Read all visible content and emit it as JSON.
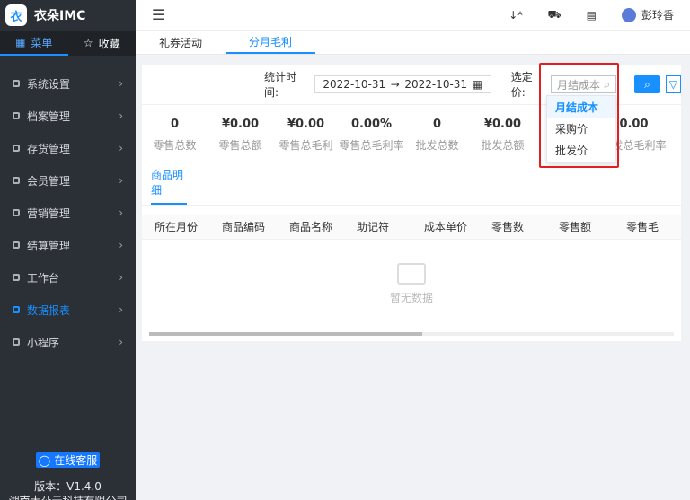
{
  "app": {
    "name": "衣朵IMC",
    "logo_text": "衣"
  },
  "side_tabs": {
    "menu": "菜单",
    "favorites": "收藏"
  },
  "menu_items": [
    {
      "label": "系统设置"
    },
    {
      "label": "档案管理"
    },
    {
      "label": "存货管理"
    },
    {
      "label": "会员管理"
    },
    {
      "label": "营销管理"
    },
    {
      "label": "结算管理"
    },
    {
      "label": "工作台"
    },
    {
      "label": "数据报表"
    },
    {
      "label": "小程序"
    }
  ],
  "service_button": "在线客服",
  "version": "版本：V1.4.0",
  "company": "湖南大朵云科技有限公司",
  "top": {
    "user": "彭玲香"
  },
  "tabs": [
    "礼券活动",
    "分月毛利"
  ],
  "filter": {
    "date_label": "统计时间:",
    "start": "2022-10-31",
    "end": "2022-10-31",
    "price_label": "选定价:",
    "price_selected": "月结成本"
  },
  "stats": [
    {
      "value": "0",
      "label": "零售总数"
    },
    {
      "value": "¥0.00",
      "label": "零售总额"
    },
    {
      "value": "¥0.00",
      "label": "零售总毛利"
    },
    {
      "value": "0.00%",
      "label": "零售总毛利率"
    },
    {
      "value": "0",
      "label": "批发总数"
    },
    {
      "value": "¥0.00",
      "label": "批发总额"
    },
    {
      "value": "",
      "label": ""
    },
    {
      "value": "0.00",
      "label": "批发总毛利率"
    }
  ],
  "detail_tab": "商品明细",
  "columns": [
    "所在月份",
    "商品编码",
    "商品名称",
    "助记符",
    "成本单价",
    "零售数",
    "零售额",
    "零售毛"
  ],
  "empty_text": "暂无数据",
  "dropdown": [
    "月结成本",
    "采购价",
    "批发价"
  ],
  "colors": {
    "accent": "#1890ff",
    "sidebar": "#2b2f36",
    "highlight": "#e02020"
  }
}
